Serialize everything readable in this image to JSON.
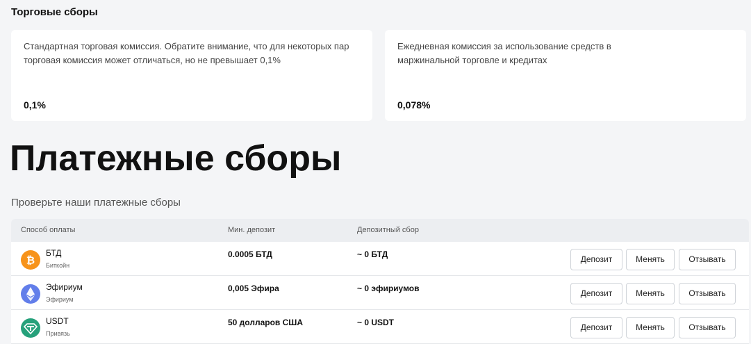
{
  "trading": {
    "title": "Торговые сборы",
    "cards": [
      {
        "desc": "Стандартная торговая комиссия. Обратите внимание, что для некоторых пар торговая комиссия может отличаться, но не превышает 0,1%",
        "value": "0,1%"
      },
      {
        "desc": "Ежедневная комиссия за использование средств в маржинальной торговле и кредитах",
        "value": "0,078%"
      }
    ]
  },
  "payments": {
    "heading": "Платежные сборы",
    "subheading": "Проверьте наши платежные сборы",
    "columns": {
      "method": "Способ оплаты",
      "min_deposit": "Мин. депозит",
      "deposit_fee": "Депозитный сбор"
    },
    "buttons": {
      "deposit": "Депозит",
      "exchange": "Менять",
      "withdraw": "Отзывать"
    },
    "rows": [
      {
        "name": "БТД",
        "sub": "Биткойн",
        "min_deposit": "0.0005 БТД",
        "deposit_fee": "~ 0 БТД",
        "icon": "bitcoin-icon",
        "color": "#f7931a"
      },
      {
        "name": "Эфириум",
        "sub": "Эфириум",
        "min_deposit": "0,005 Эфира",
        "deposit_fee": "~ 0 эфириумов",
        "icon": "ethereum-icon",
        "color": "#627eea"
      },
      {
        "name": "USDT",
        "sub": "Привязь",
        "min_deposit": "50 долларов США",
        "deposit_fee": "~ 0 USDT",
        "icon": "tether-icon",
        "color": "#26a17b"
      }
    ]
  }
}
